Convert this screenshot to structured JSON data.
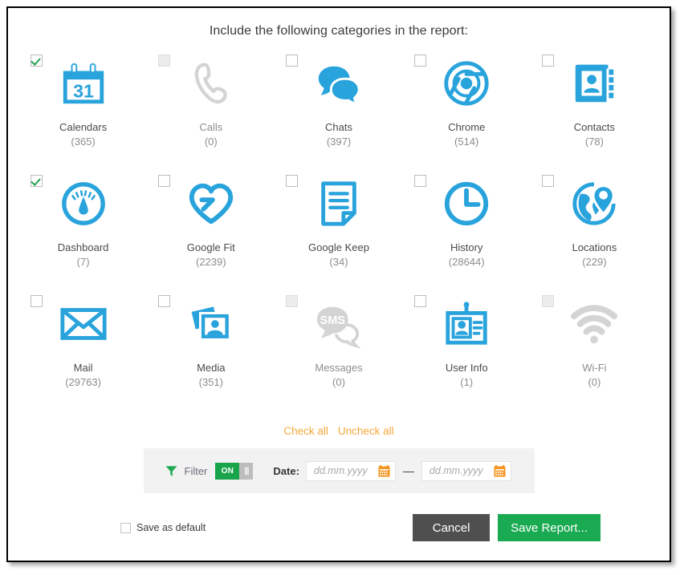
{
  "dialog": {
    "title": "Include the following categories in the report:"
  },
  "categories": [
    {
      "label": "Calendars",
      "count": "(365)",
      "icon": "calendar-icon",
      "checked": true,
      "disabled": false
    },
    {
      "label": "Calls",
      "count": "(0)",
      "icon": "phone-icon",
      "checked": false,
      "disabled": true
    },
    {
      "label": "Chats",
      "count": "(397)",
      "icon": "chat-bubbles-icon",
      "checked": false,
      "disabled": false
    },
    {
      "label": "Chrome",
      "count": "(514)",
      "icon": "chrome-icon",
      "checked": false,
      "disabled": false
    },
    {
      "label": "Contacts",
      "count": "(78)",
      "icon": "contacts-book-icon",
      "checked": false,
      "disabled": false
    },
    {
      "label": "Dashboard",
      "count": "(7)",
      "icon": "gauge-icon",
      "checked": true,
      "disabled": false
    },
    {
      "label": "Google Fit",
      "count": "(2239)",
      "icon": "heart-icon",
      "checked": false,
      "disabled": false
    },
    {
      "label": "Google Keep",
      "count": "(34)",
      "icon": "note-icon",
      "checked": false,
      "disabled": false
    },
    {
      "label": "History",
      "count": "(28644)",
      "icon": "clock-icon",
      "checked": false,
      "disabled": false
    },
    {
      "label": "Locations",
      "count": "(229)",
      "icon": "globe-pin-icon",
      "checked": false,
      "disabled": false
    },
    {
      "label": "Mail",
      "count": "(29763)",
      "icon": "envelope-icon",
      "checked": false,
      "disabled": false
    },
    {
      "label": "Media",
      "count": "(351)",
      "icon": "photos-icon",
      "checked": false,
      "disabled": false
    },
    {
      "label": "Messages",
      "count": "(0)",
      "icon": "sms-bubble-icon",
      "checked": false,
      "disabled": true
    },
    {
      "label": "User Info",
      "count": "(1)",
      "icon": "id-badge-icon",
      "checked": false,
      "disabled": false
    },
    {
      "label": "Wi-Fi",
      "count": "(0)",
      "icon": "wifi-icon",
      "checked": false,
      "disabled": true
    }
  ],
  "links": {
    "check_all": "Check all",
    "uncheck_all": "Uncheck all"
  },
  "filter": {
    "icon": "funnel-icon",
    "label": "Filter",
    "toggle_state": "ON",
    "date_label": "Date:",
    "date_from_value": "",
    "date_from_placeholder": "dd.mm.yyyy",
    "date_to_value": "",
    "date_to_placeholder": "dd.mm.yyyy",
    "date_separator": "—",
    "calendar_icon": "calendar-picker-icon"
  },
  "footer": {
    "save_as_default_label": "Save as default",
    "save_as_default_checked": false,
    "cancel_label": "Cancel",
    "save_report_label": "Save Report..."
  },
  "colors": {
    "icon_blue": "#29a3dc",
    "icon_gray": "#d4d4d4",
    "link_orange": "#f5a93c",
    "green": "#1aaa52",
    "check_green": "#22a14b",
    "cancel_gray": "#4f4f4f",
    "calendar_orange": "#f5941e"
  }
}
